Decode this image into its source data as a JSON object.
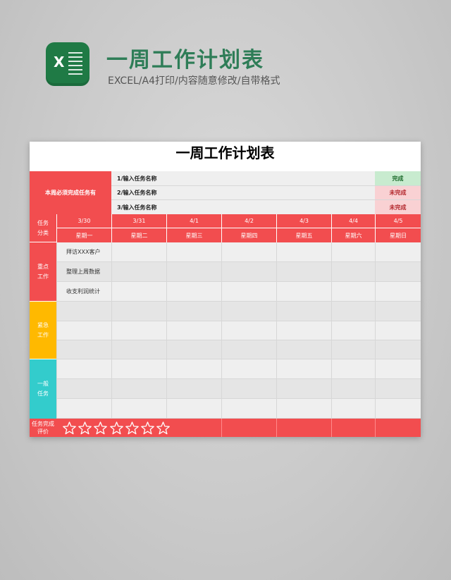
{
  "header": {
    "logo_letter": "X",
    "title": "一周工作计划表",
    "subtitle": "EXCEL/A4打印/内容随意修改/自带格式"
  },
  "sheet": {
    "title": "一周工作计划表",
    "must_label": "本周必须完成任务有",
    "tasks": [
      {
        "label": "1/输入任务名称",
        "status": "完成"
      },
      {
        "label": "2/输入任务名称",
        "status": "未完成"
      },
      {
        "label": "3/输入任务名称",
        "status": "未完成"
      }
    ],
    "category_header": "任务分类",
    "dates": [
      "3/30",
      "3/31",
      "4/1",
      "4/2",
      "4/3",
      "4/4",
      "4/5"
    ],
    "weekdays": [
      "星期一",
      "星期二",
      "星期三",
      "星期四",
      "星期五",
      "星期六",
      "星期日"
    ],
    "categories": [
      {
        "label": "重点工作",
        "color": "#f24d4f",
        "items": [
          "拜访XXX客户",
          "整理上周数据",
          "收支利润统计"
        ]
      },
      {
        "label": "紧急工作",
        "color": "#ffb900",
        "items": [
          "",
          "",
          ""
        ]
      },
      {
        "label": "一般任务",
        "color": "#33cccc",
        "items": [
          "",
          "",
          ""
        ]
      }
    ],
    "rating_label": "任务完成评价",
    "rating_stars": 7
  },
  "colors": {
    "accent_red": "#f24d4f",
    "done_bg": "#c8ebcf",
    "undone_bg": "#f9d1d3",
    "title_green": "#2e7d57"
  }
}
